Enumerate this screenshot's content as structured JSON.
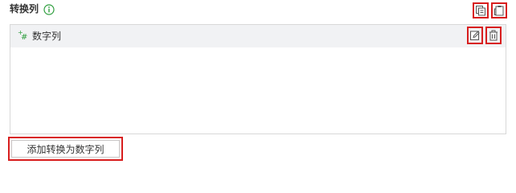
{
  "section": {
    "title": "转换列",
    "info_icon": "info-circle-icon",
    "accent_color": "#2e9e3e"
  },
  "toolbar": {
    "copy_icon": "copy-icon",
    "paste_icon": "paste-icon"
  },
  "columns": [
    {
      "label": "数字列",
      "type_icon": "numeric-add-icon",
      "actions": [
        "edit-icon",
        "delete-icon"
      ]
    }
  ],
  "add_button": {
    "label": "添加转换为数字列"
  },
  "highlight_color": "#d81e1e"
}
